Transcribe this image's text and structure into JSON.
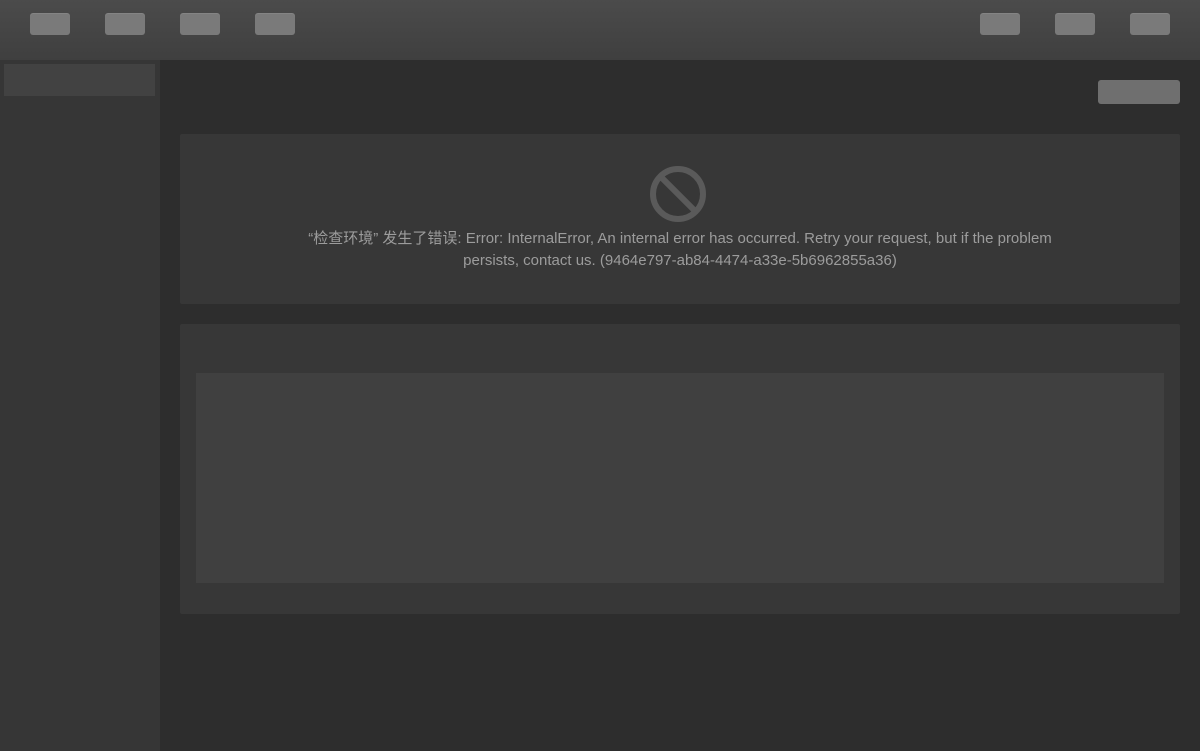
{
  "error": {
    "icon": "ban-icon",
    "message": "“检查环境” 发生了错误: Error: InternalError, An internal error has occurred. Retry your request, but if the problem persists, contact us. (9464e797-ab84-4474-a33e-5b6962855a36)"
  },
  "colors": {
    "topbar": "#444444",
    "sidebar": "#363636",
    "main_bg": "#2d2d2d",
    "panel": "#373737",
    "error_text": "#9c9c9c",
    "icon": "#5a5a5a"
  }
}
